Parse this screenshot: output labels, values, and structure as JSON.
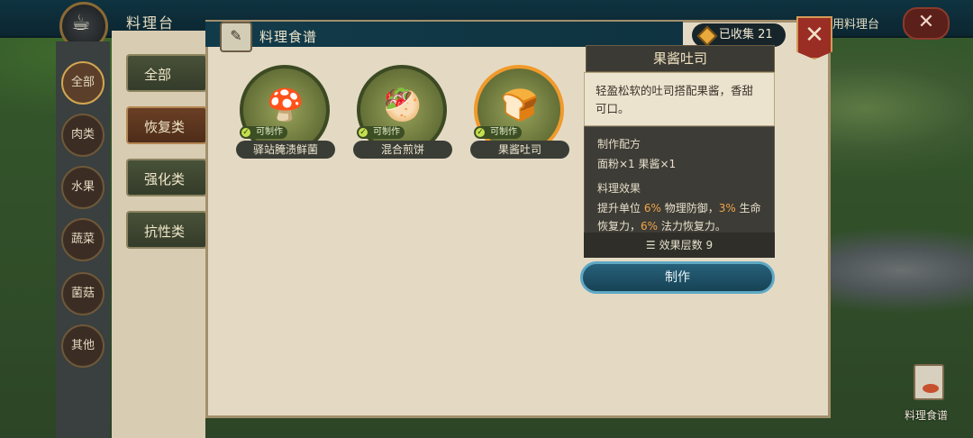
{
  "topbar": {
    "title": "料理台",
    "right_label": "用料理台",
    "close_symbol": "✕"
  },
  "left_nav": [
    {
      "label": "全部",
      "active": true
    },
    {
      "label": "肉类",
      "active": false
    },
    {
      "label": "水果",
      "active": false
    },
    {
      "label": "蔬菜",
      "active": false
    },
    {
      "label": "菌菇",
      "active": false
    },
    {
      "label": "其他",
      "active": false
    }
  ],
  "tabs": [
    {
      "label": "全部",
      "active": false
    },
    {
      "label": "恢复类",
      "active": true
    },
    {
      "label": "强化类",
      "active": false
    },
    {
      "label": "抗性类",
      "active": false
    }
  ],
  "dialog": {
    "title": "料理食谱",
    "collected": "已收集 21",
    "close_symbol": "✕"
  },
  "recipes": [
    {
      "name": "驿站腌渍鲜菌",
      "craftable_label": "可制作",
      "icon": "mushroom-dish-icon",
      "glyph": "🍄",
      "selected": false
    },
    {
      "name": "混合煎饼",
      "craftable_label": "可制作",
      "icon": "pancake-wrap-icon",
      "glyph": "🥙",
      "selected": false
    },
    {
      "name": "果酱吐司",
      "craftable_label": "可制作",
      "icon": "jam-toast-icon",
      "glyph": "🍞",
      "selected": true
    }
  ],
  "detail": {
    "title": "果酱吐司",
    "description": "轻盈松软的吐司搭配果酱，香甜可口。",
    "recipe_title": "制作配方",
    "recipe_line": "面粉×1 果酱×1",
    "effect_title": "料理效果",
    "effect": {
      "p1": "提升单位 ",
      "v1": "6%",
      "p2": " 物理防御，",
      "v2": "3%",
      "p3": " 生命恢复力，",
      "v3": "6%",
      "p4": " 法力恢复力。"
    },
    "layers": "效果层数 9",
    "craft_button": "制作"
  },
  "corner": {
    "book_label": "料理食谱"
  },
  "colors": {
    "accent_orange": "#f2a54a",
    "header_teal": "#0f3340",
    "craft_blue": "#27607a",
    "selected_frame": "#f09a2b"
  }
}
